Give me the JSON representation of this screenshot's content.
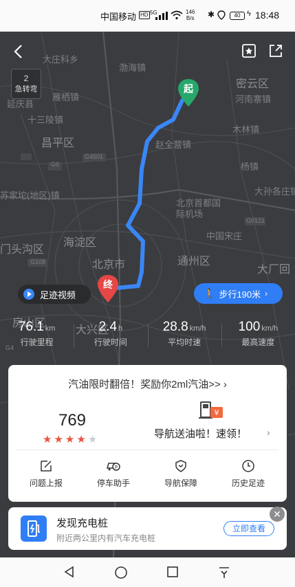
{
  "status_bar": {
    "carrier": "中国移动",
    "hd": "HD",
    "signal": "5G",
    "speed_value": "146",
    "speed_unit": "B/s",
    "battery": "40",
    "time": "18:48"
  },
  "map": {
    "labels": [
      "大庄科乡",
      "渤海镇",
      "密云区",
      "雁栖镇",
      "河南寨镇",
      "延庆县",
      "十三陵镇",
      "木林镇",
      "昌平区",
      "赵全营镇",
      "杨镇",
      "G4501",
      "苏家坨(地区)镇",
      "北京首都国际机场",
      "大孙各庄镇",
      "G6",
      "海淀区",
      "中国宋庄",
      "门头沟区",
      "北京市",
      "通州区",
      "大厂回",
      "房山区",
      "大兴区",
      "G4",
      "G108",
      "G0121"
    ],
    "start_pin": "起",
    "end_pin": "终",
    "route_color": "#3a86f6"
  },
  "top": {
    "sharp_turn_count": "2",
    "sharp_turn_label": "急转弯"
  },
  "buttons": {
    "footprint_video": "足迹视频",
    "walk": "步行190米"
  },
  "stats": [
    {
      "value": "76.1",
      "unit": "km",
      "label": "行驶里程"
    },
    {
      "value": "2.4",
      "unit": "h",
      "label": "行驶时间"
    },
    {
      "value": "28.8",
      "unit": "km/h",
      "label": "平均时速"
    },
    {
      "value": "100",
      "unit": "km/h",
      "label": "最高速度"
    }
  ],
  "card": {
    "promo": "汽油限时翻倍！奖励你2ml汽油>> ›",
    "score": "769",
    "stars_filled": 4,
    "stars_total": 5,
    "fuel_promo": "导航送油啦！速领！",
    "tools": [
      "问题上报",
      "停车助手",
      "导航保障",
      "历史足迹"
    ]
  },
  "charging": {
    "title": "发现充电桩",
    "subtitle": "附近两公里内有汽车充电桩",
    "button": "立即查看"
  },
  "colors": {
    "accent": "#2f7ef5",
    "start_pin": "#26a86b",
    "end_pin": "#e64646",
    "star": "#e8533f"
  }
}
